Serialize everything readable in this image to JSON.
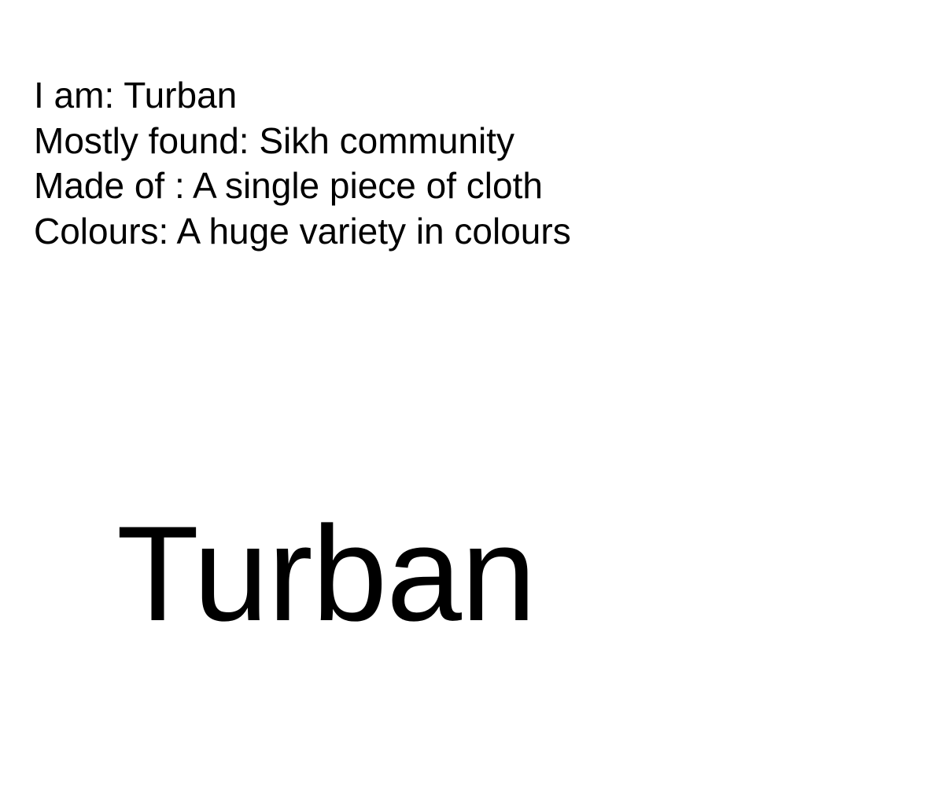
{
  "info": {
    "lines": [
      "I am: Turban",
      "Mostly found: Sikh community",
      "Made of : A single piece of cloth",
      "Colours: A huge variety in colours"
    ]
  },
  "title": "Turban",
  "colors": {
    "background": "#ffffff",
    "text": "#000000"
  }
}
